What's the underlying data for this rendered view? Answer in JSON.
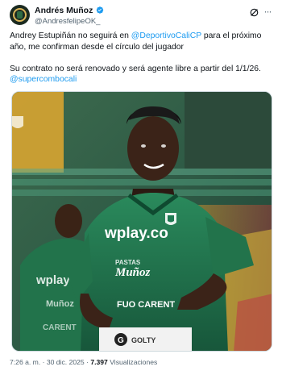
{
  "tweet": {
    "author": {
      "display_name": "Andrés Muñoz",
      "handle": "@AndresfelipeOK_",
      "verified": true,
      "avatar_icon": "circular-badge-avatar"
    },
    "actions": {
      "grok_icon": "grok-icon",
      "more_icon": "more-options-icon",
      "more_label": "···"
    },
    "text": {
      "line1_before": "Andrey Estupiñán no seguirá en ",
      "line1_mention": "@DeportivoCaliCP",
      "line1_after": " para el próximo año, me confirman desde el círculo del jugador",
      "line2_before": "Su contrato no será renovado y será agente libre a partir del 1/1/26.",
      "line3_mention": "@supercombocali"
    },
    "media": {
      "description_icon": "photo-player-green-jersey",
      "jersey_sponsor": "wplay.co",
      "jersey_sponsor_bg": "wplay",
      "jersey_sleeve_logo": "FUO CARENT",
      "jersey_small": "PASTAS Muñoz"
    },
    "meta": {
      "time": "7:26 a. m.",
      "sep1": " · ",
      "date": "30 dic. 2025",
      "sep2": " · ",
      "views_count": "7.397",
      "views_label": " Visualizaciones"
    },
    "colors": {
      "link": "#1d9bf0",
      "verified": "#1d9bf0",
      "jersey_green": "#1f7a52",
      "secondary_text": "#536471"
    }
  }
}
